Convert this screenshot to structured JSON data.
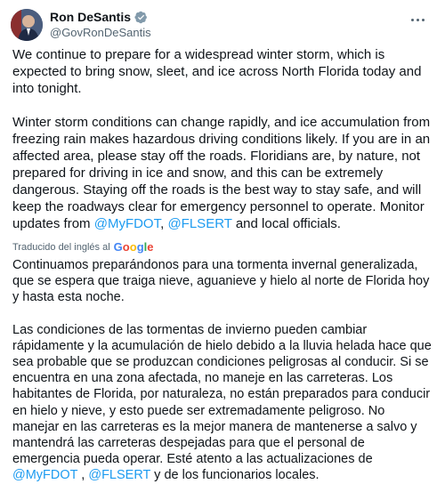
{
  "author": {
    "display_name": "Ron DeSantis",
    "handle": "@GovRonDeSantis",
    "verified_icon": "verified-badge-icon",
    "more_icon": "more-options-icon"
  },
  "tweet": {
    "p1": "We continue to prepare for a widespread winter storm, which is expected to bring snow, sleet, and ice across North Florida today and into tonight.",
    "p2_text": "Winter storm conditions can change rapidly, and ice accumulation from freezing rain makes hazardous driving conditions likely. If you are in an affected area, please stay off the roads. Floridians are, by nature, not prepared for driving in ice and snow, and this can be extremely dangerous. Staying off the roads is the best way to stay safe, and will keep the roadways clear for emergency personnel to operate. Monitor updates from ",
    "mention1": "@MyFDOT",
    "sep1": ", ",
    "mention2": "@FLSERT",
    "p2_end": " and local officials."
  },
  "translation": {
    "label": "Traducido del inglés al",
    "provider": "Google",
    "p1": "Continuamos preparándonos para una tormenta invernal generalizada, que se espera que traiga nieve, aguanieve y hielo al norte de Florida hoy y hasta esta noche.",
    "p2_text": "Las condiciones de las tormentas de invierno pueden cambiar rápidamente y la acumulación de hielo debido a la lluvia helada hace que sea probable que se produzcan condiciones peligrosas al conducir. Si se encuentra en una zona afectada, no maneje en las carreteras. Los habitantes de Florida, por naturaleza, no están preparados para conducir en hielo y nieve, y esto puede ser extremadamente peligroso. No manejar en las carreteras es la mejor manera de mantenerse a salvo y mantendrá las carreteras despejadas para que el personal de emergencia pueda operar. Esté atento a las actualizaciones de ",
    "mention1": "@MyFDOT",
    "sep1": " , ",
    "mention2": "@FLSERT",
    "p2_end": " y de los funcionarios locales."
  },
  "colors": {
    "link": "#1d9bf0",
    "text": "#0f1419",
    "muted": "#536471"
  }
}
